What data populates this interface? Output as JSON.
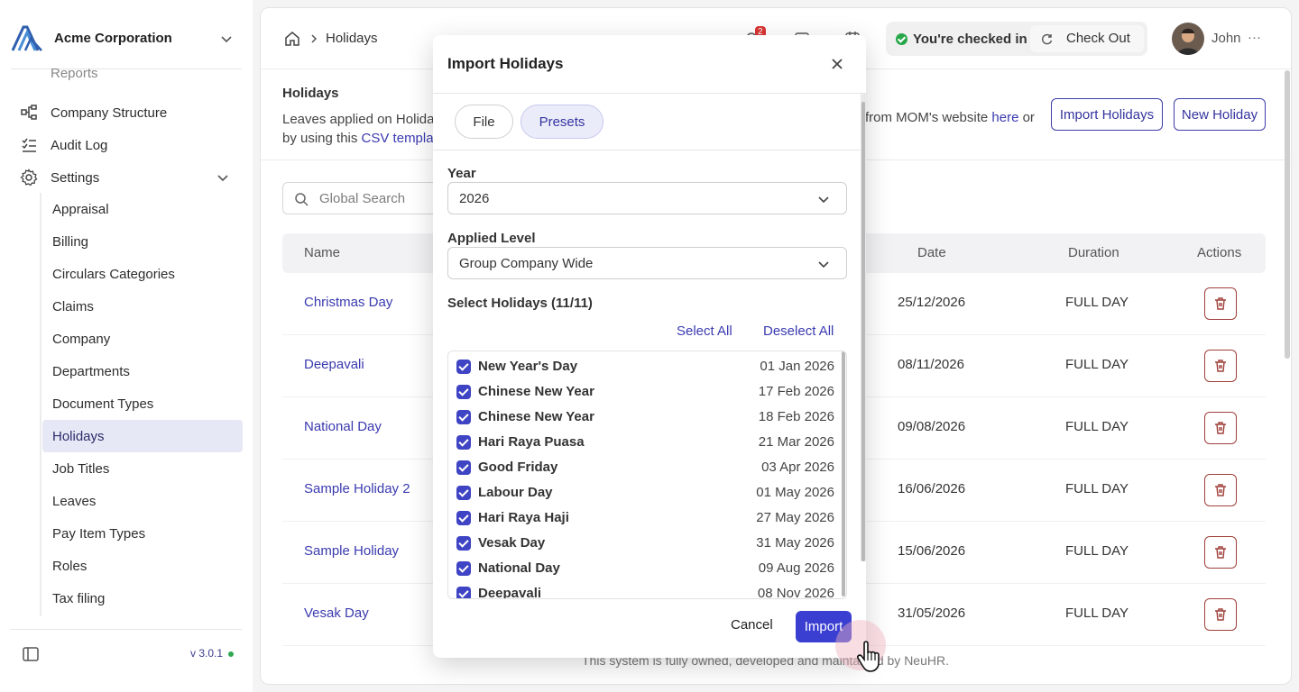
{
  "sidebar": {
    "company": "Acme Corporation",
    "partial_item": "Reports",
    "items": [
      {
        "label": "Company Structure",
        "icon": "hierarchy-icon"
      },
      {
        "label": "Audit Log",
        "icon": "list-check-icon"
      },
      {
        "label": "Settings",
        "icon": "gear-icon"
      }
    ],
    "settings_children": [
      "Appraisal",
      "Billing",
      "Circulars Categories",
      "Claims",
      "Company",
      "Departments",
      "Document Types",
      "Holidays",
      "Job Titles",
      "Leaves",
      "Pay Item Types",
      "Roles",
      "Tax filing"
    ],
    "active_child": "Holidays",
    "version": "v 3.0.1"
  },
  "topbar": {
    "breadcrumb": "Holidays",
    "notification_count": "2",
    "checked_in": "You're checked in",
    "check_out": "Check Out",
    "user": "John",
    "more": "···"
  },
  "page": {
    "title": "Holidays",
    "desc_start": "Leaves applied on Holiday",
    "desc_line2": "by using this ",
    "csv_link": "CSV templat",
    "desc_right": "from MOM's website ",
    "here_link": "here",
    "desc_right_end": " or",
    "import_button": "Import Holidays",
    "new_button": "New Holiday",
    "search_placeholder": "Global Search"
  },
  "table": {
    "headers": {
      "name": "Name",
      "date": "Date",
      "duration": "Duration",
      "actions": "Actions"
    },
    "rows": [
      {
        "name": "Christmas Day",
        "date": "25/12/2026",
        "duration": "FULL DAY"
      },
      {
        "name": "Deepavali",
        "date": "08/11/2026",
        "duration": "FULL DAY"
      },
      {
        "name": "National Day",
        "date": "09/08/2026",
        "duration": "FULL DAY"
      },
      {
        "name": "Sample Holiday 2",
        "date": "16/06/2026",
        "duration": "FULL DAY"
      },
      {
        "name": "Sample Holiday",
        "date": "15/06/2026",
        "duration": "FULL DAY"
      },
      {
        "name": "Vesak Day",
        "date": "31/05/2026",
        "duration": "FULL DAY"
      }
    ]
  },
  "footer": "This system is fully owned, developed and maintained by NeuHR.",
  "modal": {
    "title": "Import Holidays",
    "tabs": {
      "file": "File",
      "presets": "Presets"
    },
    "active_tab": "Presets",
    "year_label": "Year",
    "year_value": "2026",
    "level_label": "Applied Level",
    "level_value": "Group Company Wide",
    "select_label": "Select Holidays (11/11)",
    "select_all": "Select All",
    "deselect_all": "Deselect All",
    "holidays": [
      {
        "name": "New Year's Day",
        "date": "01 Jan 2026",
        "checked": true
      },
      {
        "name": "Chinese New Year",
        "date": "17 Feb 2026",
        "checked": true
      },
      {
        "name": "Chinese New Year",
        "date": "18 Feb 2026",
        "checked": true
      },
      {
        "name": "Hari Raya Puasa",
        "date": "21 Mar 2026",
        "checked": true
      },
      {
        "name": "Good Friday",
        "date": "03 Apr 2026",
        "checked": true
      },
      {
        "name": "Labour Day",
        "date": "01 May 2026",
        "checked": true
      },
      {
        "name": "Hari Raya Haji",
        "date": "27 May 2026",
        "checked": true
      },
      {
        "name": "Vesak Day",
        "date": "31 May 2026",
        "checked": true
      },
      {
        "name": "National Day",
        "date": "09 Aug 2026",
        "checked": true
      },
      {
        "name": "Deepavali",
        "date": "08 Nov 2026",
        "checked": true
      }
    ],
    "cancel": "Cancel",
    "import": "Import"
  },
  "colors": {
    "accent": "#3a3fd1",
    "link": "#3a3ab0",
    "danger": "#a0403a",
    "success": "#27a74a"
  }
}
